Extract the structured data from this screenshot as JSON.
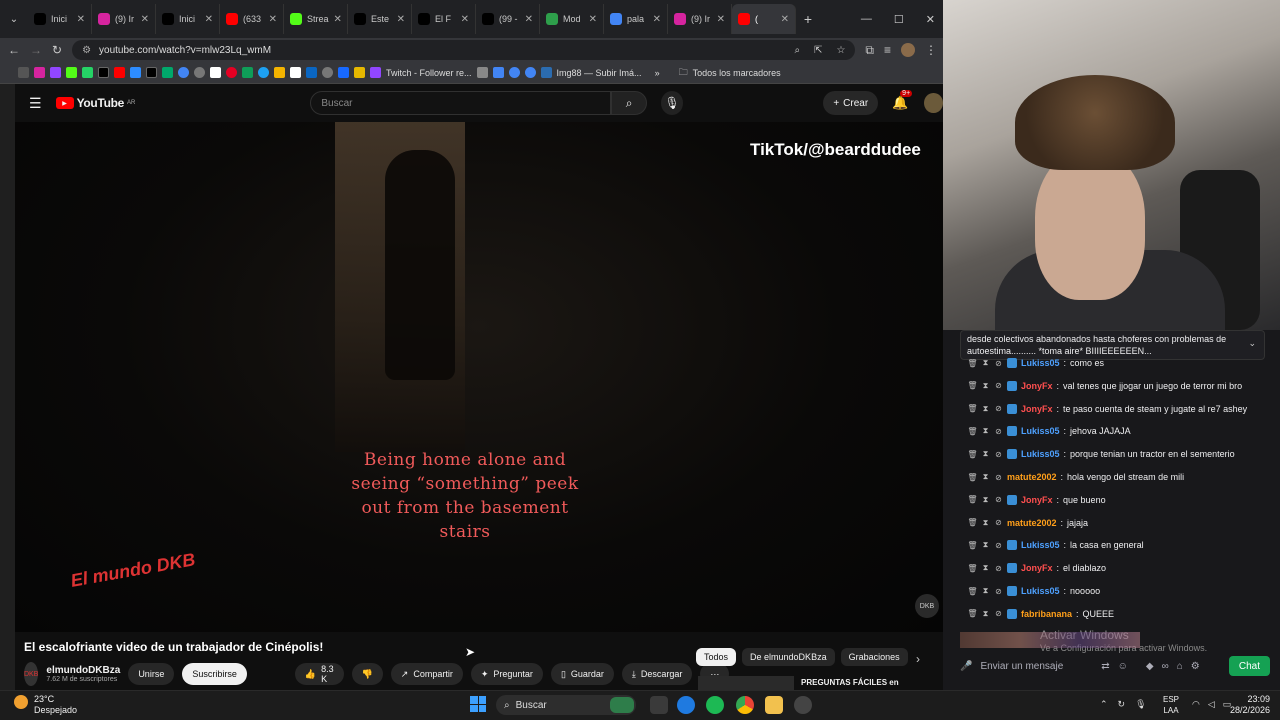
{
  "browser": {
    "tabs": [
      {
        "label": "Inici",
        "icon": "x-icon",
        "color": "#000000"
      },
      {
        "label": "(9) Ir",
        "icon": "instagram-icon",
        "color": "#d6249f"
      },
      {
        "label": "Inici",
        "icon": "x-icon",
        "color": "#000000"
      },
      {
        "label": "(633",
        "icon": "youtube-icon",
        "color": "#ff0000"
      },
      {
        "label": "Strea",
        "icon": "kick-icon",
        "color": "#53fc18"
      },
      {
        "label": "Este",
        "icon": "tiktok-icon",
        "color": "#000000"
      },
      {
        "label": "El F",
        "icon": "tiktok-icon",
        "color": "#000000"
      },
      {
        "label": "(99 -",
        "icon": "tiktok-icon",
        "color": "#000000"
      },
      {
        "label": "Mod",
        "icon": "p-icon",
        "color": "#2e9f4b"
      },
      {
        "label": "pala",
        "icon": "google-icon",
        "color": "#4285f4"
      },
      {
        "label": "(9) Ir",
        "icon": "instagram-icon",
        "color": "#d6249f"
      },
      {
        "label": "(",
        "icon": "youtube-icon",
        "color": "#ff0000"
      }
    ],
    "url": "youtube.com/watch?v=mlw23Lq_wmM",
    "bookmarks": {
      "twitch": "Twitch - Follower re...",
      "imgbb": "Img88 — Subir Imá...",
      "all": "Todos los marcadores"
    }
  },
  "youtube": {
    "logo": "YouTube",
    "region": "AR",
    "search_placeholder": "Buscar",
    "create_label": "Crear",
    "notifications": "9+",
    "video": {
      "watermark": "TikTok/@bearddudee",
      "caption": "Being home alone and seeing “something” peek out from the basement stairs",
      "logo_left": "El mundo DKB",
      "logo_right": "DKB"
    },
    "title": "El escalofriante video de un trabajador de Cinépolis!",
    "channel": {
      "name": "elmundoDKBza",
      "subscribers": "7.62 M de suscriptores",
      "join": "Unirse",
      "subscribe": "Suscribirse"
    },
    "actions": {
      "likes": "8.3 K",
      "share": "Compartir",
      "ask": "Preguntar",
      "save": "Guardar",
      "download": "Descargar"
    },
    "chips": [
      "Todos",
      "De elmundoDKBza",
      "Grabaciones"
    ],
    "next_video": "PREGUNTAS FÁCILES en"
  },
  "chat": {
    "pinned": "desde colectivos abandonados hasta choferes con problemas de autoestima.......... *toma aire* BIIIIEEEEEEN...",
    "messages": [
      {
        "user": "Lukiss05",
        "color": "#4ea1ff",
        "text": "como es"
      },
      {
        "user": "JonyFx",
        "color": "#ff4f4f",
        "text": "val tenes que jjogar un juego de terror mi bro"
      },
      {
        "user": "JonyFx",
        "color": "#ff4f4f",
        "text": "te paso cuenta de steam y jugate al re7 ashey"
      },
      {
        "user": "Lukiss05",
        "color": "#4ea1ff",
        "text": "jehova JAJAJA"
      },
      {
        "user": "Lukiss05",
        "color": "#4ea1ff",
        "text": "porque tenian un tractor en el sementerio"
      },
      {
        "user": "matute2002",
        "color": "#ff9f1a",
        "text": "hola vengo del stream de mili"
      },
      {
        "user": "JonyFx",
        "color": "#ff4f4f",
        "text": "que bueno"
      },
      {
        "user": "matute2002",
        "color": "#ff9f1a",
        "text": "jajaja"
      },
      {
        "user": "Lukiss05",
        "color": "#4ea1ff",
        "text": "la casa en general"
      },
      {
        "user": "JonyFx",
        "color": "#ff4f4f",
        "text": "el diablazo"
      },
      {
        "user": "Lukiss05",
        "color": "#4ea1ff",
        "text": "nooooo"
      },
      {
        "user": "fabribanana",
        "color": "#ff9f1a",
        "text": "QUEEE"
      }
    ],
    "activate_windows": "Activar Windows",
    "activate_windows_sub": "Ve a Configuración para activar Windows.",
    "input_placeholder": "Enviar un mensaje",
    "chat_button": "Chat"
  },
  "taskbar": {
    "weather_temp": "23°C",
    "weather_desc": "Despejado",
    "search": "Buscar",
    "lang": "ESP",
    "lang2": "LAA",
    "time": "23:09",
    "date": "28/2/2026"
  }
}
